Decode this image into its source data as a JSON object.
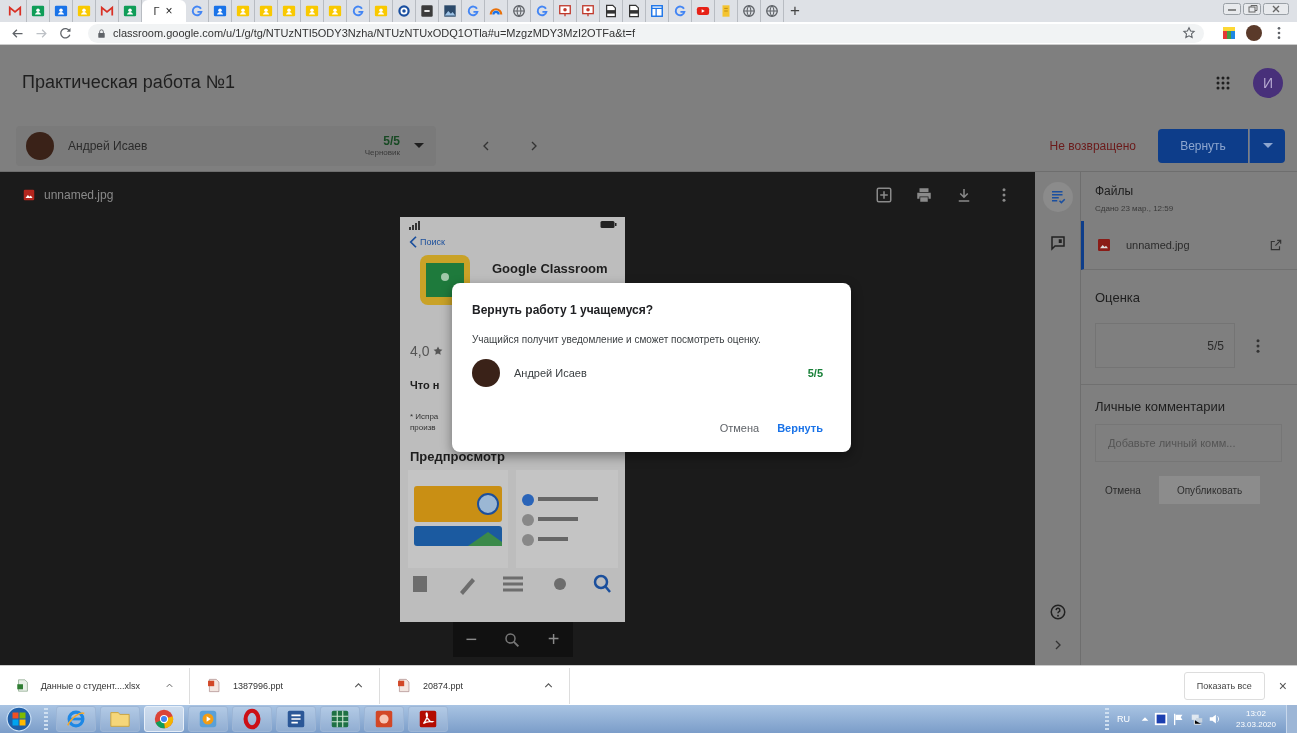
{
  "browser": {
    "tabs": [
      {
        "kind": "mail",
        "selected": false
      },
      {
        "kind": "board",
        "color": "#0f9d58",
        "selected": false
      },
      {
        "kind": "board",
        "color": "#1a73e8",
        "selected": false
      },
      {
        "kind": "board",
        "color": "#f9c900",
        "selected": false
      },
      {
        "kind": "mail",
        "selected": false
      },
      {
        "kind": "board",
        "color": "#0f9d58",
        "selected": false
      },
      {
        "kind": "page",
        "selected": true,
        "title": "Г",
        "close": "×"
      },
      {
        "kind": "g",
        "selected": false
      },
      {
        "kind": "board",
        "color": "#1a73e8",
        "selected": false
      },
      {
        "kind": "board",
        "color": "#f9c900",
        "selected": false
      },
      {
        "kind": "board",
        "color": "#f9c900",
        "selected": false
      },
      {
        "kind": "board",
        "color": "#f9c900",
        "selected": false
      },
      {
        "kind": "board",
        "color": "#f9c900",
        "selected": false
      },
      {
        "kind": "board",
        "color": "#f9c900",
        "selected": false
      },
      {
        "kind": "g",
        "selected": false
      },
      {
        "kind": "board",
        "color": "#f9c900",
        "selected": false
      },
      {
        "kind": "ring",
        "selected": false
      },
      {
        "kind": "square",
        "selected": false
      },
      {
        "kind": "image",
        "selected": false
      },
      {
        "kind": "g",
        "selected": false
      },
      {
        "kind": "arc",
        "selected": false
      },
      {
        "kind": "globe",
        "selected": false
      },
      {
        "kind": "g",
        "selected": false
      },
      {
        "kind": "slides",
        "selected": false
      },
      {
        "kind": "slides",
        "selected": false
      },
      {
        "kind": "doc",
        "selected": false
      },
      {
        "kind": "doc",
        "selected": false
      },
      {
        "kind": "window",
        "selected": false
      },
      {
        "kind": "g",
        "selected": false
      },
      {
        "kind": "play",
        "selected": false
      },
      {
        "kind": "note",
        "selected": false
      },
      {
        "kind": "globe",
        "selected": false
      },
      {
        "kind": "globe",
        "selected": false
      }
    ],
    "new_tab": "+",
    "address": "classroom.google.com/u/1/g/tg/NTUzNTI5ODY3Nzha/NTUzNTUxODQ1OTla#u=MzgzMDY3MzI2OTFa&t=f"
  },
  "app": {
    "title": "Практическая работа №1",
    "avatar_letter": "И"
  },
  "student_bar": {
    "name": "Андрей Исаев",
    "grade": "5/5",
    "status": "Черновик",
    "return_state": "Не возвращено",
    "return_button": "Вернуть"
  },
  "viewer": {
    "file_name": "unnamed.jpg",
    "zoom_out": "−",
    "zoom_in": "+",
    "phone": {
      "back": "Поиск",
      "app_name": "Google Classroom",
      "rating": "4,0",
      "heading": "Что н",
      "notes": [
        "* Испра",
        "произв"
      ],
      "section": "Предпросмотр"
    }
  },
  "dialog": {
    "title": "Вернуть работу 1 учащемуся?",
    "message": "Учащийся получит уведомление и сможет посмотреть оценку.",
    "student": {
      "name": "Андрей Исаев",
      "grade": "5/5"
    },
    "buttons": [
      {
        "label": "Отмена",
        "kind": "text"
      },
      {
        "label": "Вернуть",
        "kind": "primary"
      }
    ]
  },
  "side_panel": {
    "rail": [
      {
        "kind": "files",
        "selected": true
      },
      {
        "kind": "comments",
        "selected": false
      }
    ],
    "files_title": "Файлы",
    "submitted": "Сдано 23 мар., 12:59",
    "file": "unnamed.jpg",
    "grade_title": "Оценка",
    "grade": "5/5",
    "comments_title": "Личные комментарии",
    "comment_placeholder": "Добавьте личный комм...",
    "cancel": "Отмена",
    "post": {
      "label": "Опубликовать",
      "disabled": true
    }
  },
  "downloads": {
    "items": [
      {
        "name": "Данные о студент....xlsx",
        "kind": "sheet"
      },
      {
        "name": "1387996.ppt",
        "kind": "slides"
      },
      {
        "name": "20874.ppt",
        "kind": "slides"
      }
    ],
    "show_all": "Показать все",
    "close": "×"
  },
  "taskbar": {
    "apps": [
      {
        "kind": "ie",
        "selected": false
      },
      {
        "kind": "folder",
        "selected": false
      },
      {
        "kind": "chrome",
        "selected": true
      },
      {
        "kind": "media",
        "selected": false
      },
      {
        "kind": "opera",
        "selected": false
      },
      {
        "kind": "word",
        "selected": false
      },
      {
        "kind": "excel",
        "selected": false
      },
      {
        "kind": "ppt",
        "selected": false
      },
      {
        "kind": "acrobat",
        "selected": false
      }
    ],
    "language": "RU",
    "time": "13:02",
    "date": "23.03.2020"
  }
}
